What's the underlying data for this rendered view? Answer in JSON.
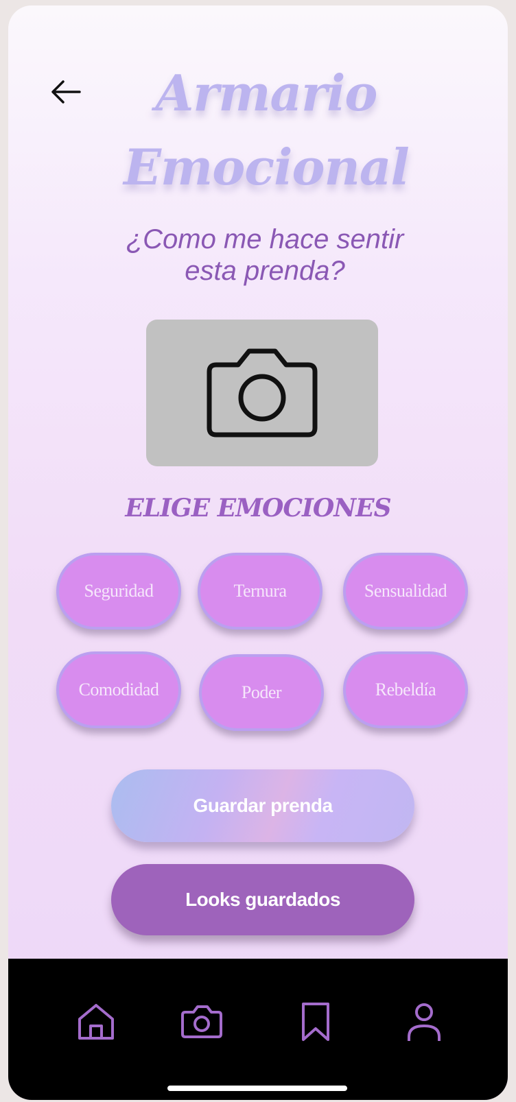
{
  "header": {
    "title_line1": "Armario",
    "title_line2": "Emocional",
    "subtitle_line1": "¿Como me hace sentir",
    "subtitle_line2": "esta prenda?"
  },
  "photo": {
    "icon": "camera-icon"
  },
  "emotions": {
    "heading": "ELIGE EMOCIONES",
    "items": [
      {
        "label": "Seguridad"
      },
      {
        "label": "Ternura"
      },
      {
        "label": "Sensualidad"
      },
      {
        "label": "Comodidad"
      },
      {
        "label": "Poder"
      },
      {
        "label": "Rebeldía"
      }
    ]
  },
  "actions": {
    "save_label": "Guardar prenda",
    "looks_label": "Looks guardados"
  },
  "bottom_nav": {
    "items": [
      {
        "icon": "home-icon"
      },
      {
        "icon": "camera-icon"
      },
      {
        "icon": "bookmark-icon"
      },
      {
        "icon": "profile-icon"
      }
    ]
  },
  "colors": {
    "accent": "#9e63bb",
    "chip": "#d88cee",
    "title": "#bcb4ef",
    "subtitle": "#8a58b4"
  }
}
